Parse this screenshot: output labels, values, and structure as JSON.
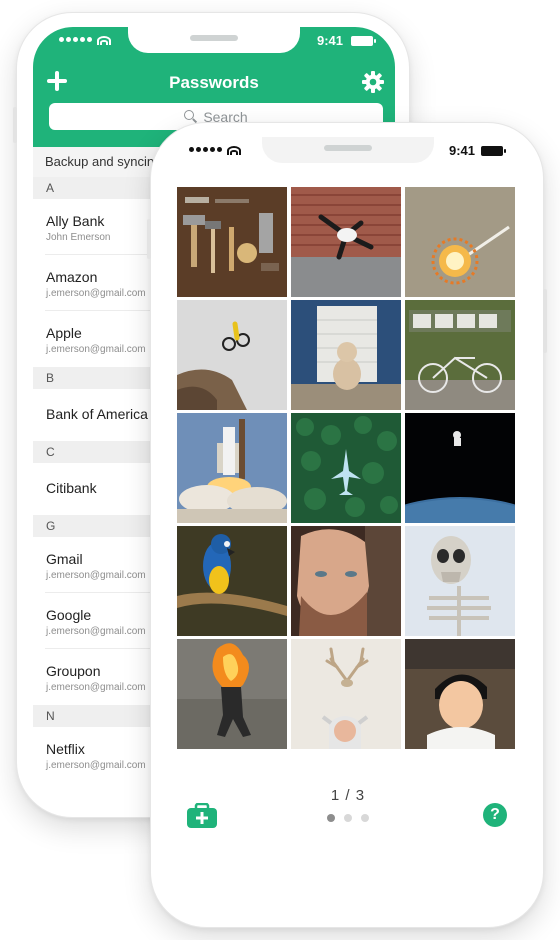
{
  "colors": {
    "accent": "#1fb37a",
    "section_bg": "#efefef",
    "text_primary": "#222222",
    "text_secondary": "#8e8e8e"
  },
  "back_phone": {
    "status_bar": {
      "time": "9:41"
    },
    "header": {
      "title": "Passwords",
      "add_icon": "plus-icon",
      "settings_icon": "gear-icon"
    },
    "search": {
      "placeholder": "Search",
      "icon": "search-icon"
    },
    "sync_banner": "Backup and syncing",
    "sections": [
      {
        "letter": "A",
        "items": [
          {
            "name": "Ally Bank",
            "subtitle": "John Emerson"
          },
          {
            "name": "Amazon",
            "subtitle": "j.emerson@gmail.com"
          },
          {
            "name": "Apple",
            "subtitle": "j.emerson@gmail.com"
          }
        ]
      },
      {
        "letter": "B",
        "items": [
          {
            "name": "Bank of America",
            "subtitle": ""
          }
        ]
      },
      {
        "letter": "C",
        "items": [
          {
            "name": "Citibank",
            "subtitle": ""
          }
        ]
      },
      {
        "letter": "G",
        "items": [
          {
            "name": "Gmail",
            "subtitle": "j.emerson@gmail.com"
          },
          {
            "name": "Google",
            "subtitle": "j.emerson@gmail.com"
          },
          {
            "name": "Groupon",
            "subtitle": "j.emerson@gmail.com"
          }
        ]
      },
      {
        "letter": "N",
        "items": [
          {
            "name": "Netflix",
            "subtitle": "j.emerson@gmail.com"
          }
        ]
      }
    ]
  },
  "front_phone": {
    "status_bar": {
      "time": "9:41"
    },
    "photos": [
      {
        "name": "tools-photo"
      },
      {
        "name": "jumper-photo"
      },
      {
        "name": "fire-flower-photo"
      },
      {
        "name": "bike-jump-photo"
      },
      {
        "name": "stuffed-toy-photo"
      },
      {
        "name": "work-bicycle-photo"
      },
      {
        "name": "rocket-launch-photo"
      },
      {
        "name": "forest-plane-photo"
      },
      {
        "name": "astronaut-earth-photo"
      },
      {
        "name": "parrot-photo"
      },
      {
        "name": "man-portrait-photo"
      },
      {
        "name": "skeleton-photo"
      },
      {
        "name": "fire-stunt-photo"
      },
      {
        "name": "antlers-man-photo"
      },
      {
        "name": "child-portrait-photo"
      }
    ],
    "pager": {
      "label": "1 / 3",
      "current": 1,
      "total": 3
    },
    "add_button_icon": "medkit-plus-icon",
    "help_button_label": "?"
  }
}
